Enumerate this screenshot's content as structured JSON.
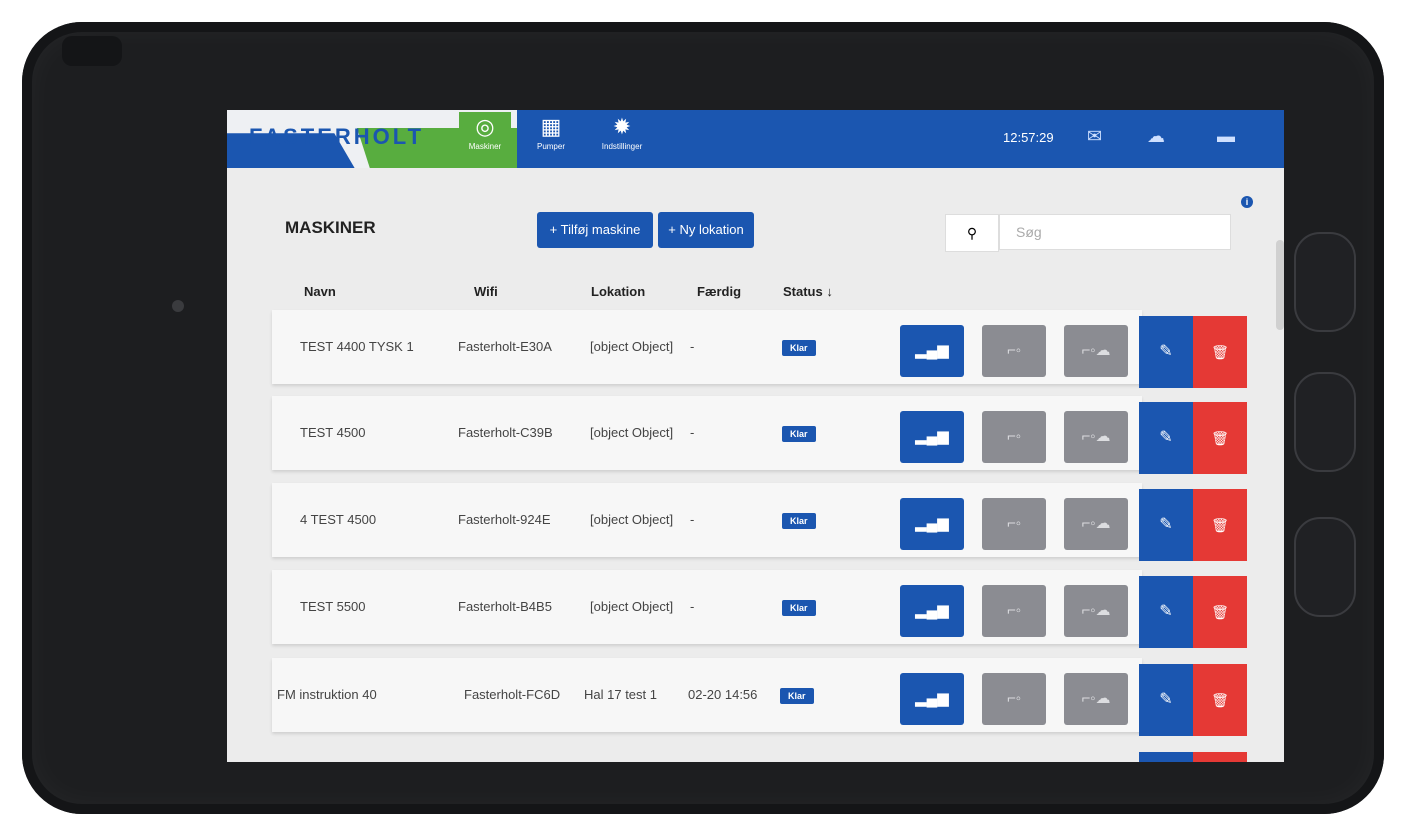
{
  "header": {
    "logo": "FASTERHOLT",
    "nav": [
      {
        "label": "Maskiner",
        "icon": "gauge-icon"
      },
      {
        "label": "Pumper",
        "icon": "grid-icon"
      },
      {
        "label": "Indstillinger",
        "icon": "gear-icon"
      }
    ],
    "time": "12:57:29"
  },
  "main": {
    "title": "MASKINER",
    "add_machine_label": "+ Tilføj maskine",
    "new_location_label": "+ Ny lokation",
    "search_placeholder": "Søg",
    "columns": [
      "Navn",
      "Wifi",
      "Lokation",
      "Færdig",
      "Status ↓"
    ],
    "rows": [
      {
        "name": "TEST 4400 TYSK 1",
        "wifi": "Fasterholt-E30A",
        "location": "[object Object]",
        "done": "-",
        "status": "Klar"
      },
      {
        "name": "TEST 4500",
        "wifi": "Fasterholt-C39B",
        "location": "[object Object]",
        "done": "-",
        "status": "Klar"
      },
      {
        "name": "4 TEST 4500",
        "wifi": "Fasterholt-924E",
        "location": "[object Object]",
        "done": "-",
        "status": "Klar"
      },
      {
        "name": "TEST 5500",
        "wifi": "Fasterholt-B4B5",
        "location": "[object Object]",
        "done": "-",
        "status": "Klar"
      },
      {
        "name": "FM instruktion 40",
        "wifi": "Fasterholt-FC6D",
        "location": "Hal 17 test 1",
        "done": "02-20 14:56",
        "status": "Klar"
      }
    ]
  },
  "colors": {
    "brand_blue": "#1b56b0",
    "brand_green": "#58ad3f",
    "delete_red": "#e53935"
  }
}
